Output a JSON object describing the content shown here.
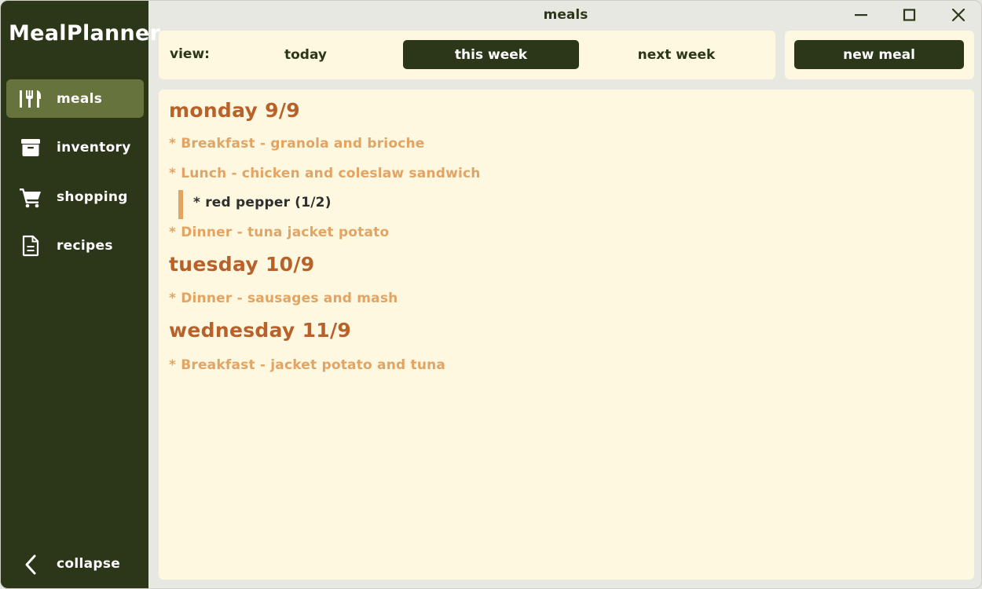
{
  "app": {
    "brand": "MealPlanner",
    "window_title": "meals"
  },
  "sidebar": {
    "items": [
      {
        "label": "meals",
        "icon": "cutlery-icon",
        "active": true
      },
      {
        "label": "inventory",
        "icon": "archive-box-icon",
        "active": false
      },
      {
        "label": "shopping",
        "icon": "shopping-cart-icon",
        "active": false
      },
      {
        "label": "recipes",
        "icon": "document-icon",
        "active": false
      }
    ],
    "collapse_label": "collapse"
  },
  "toolbar": {
    "view_label": "view:",
    "views": [
      "today",
      "this week",
      "next week"
    ],
    "selected_view": "this week",
    "new_meal_label": "new meal"
  },
  "schedule": {
    "days": [
      {
        "heading": "monday 9/9"
      },
      {
        "heading": "tuesday 10/9"
      },
      {
        "heading": "wednesday 11/9"
      }
    ],
    "meals": [
      "* Breakfast - granola and brioche",
      "* Lunch - chicken and coleslaw sandwich",
      "* Dinner - tuna jacket potato",
      "* Dinner - sausages and mash",
      "* Breakfast - jacket potato and tuna"
    ],
    "lunch_missing_ingredient": "* red pepper (1/2)"
  },
  "colors": {
    "sidebar_bg": "#2b3718",
    "active_nav": "#66733c",
    "panel_bg": "#fdf8df",
    "day_heading": "#b8612a",
    "meal_text": "#e2a464",
    "window_bg": "#e8e8e3"
  }
}
